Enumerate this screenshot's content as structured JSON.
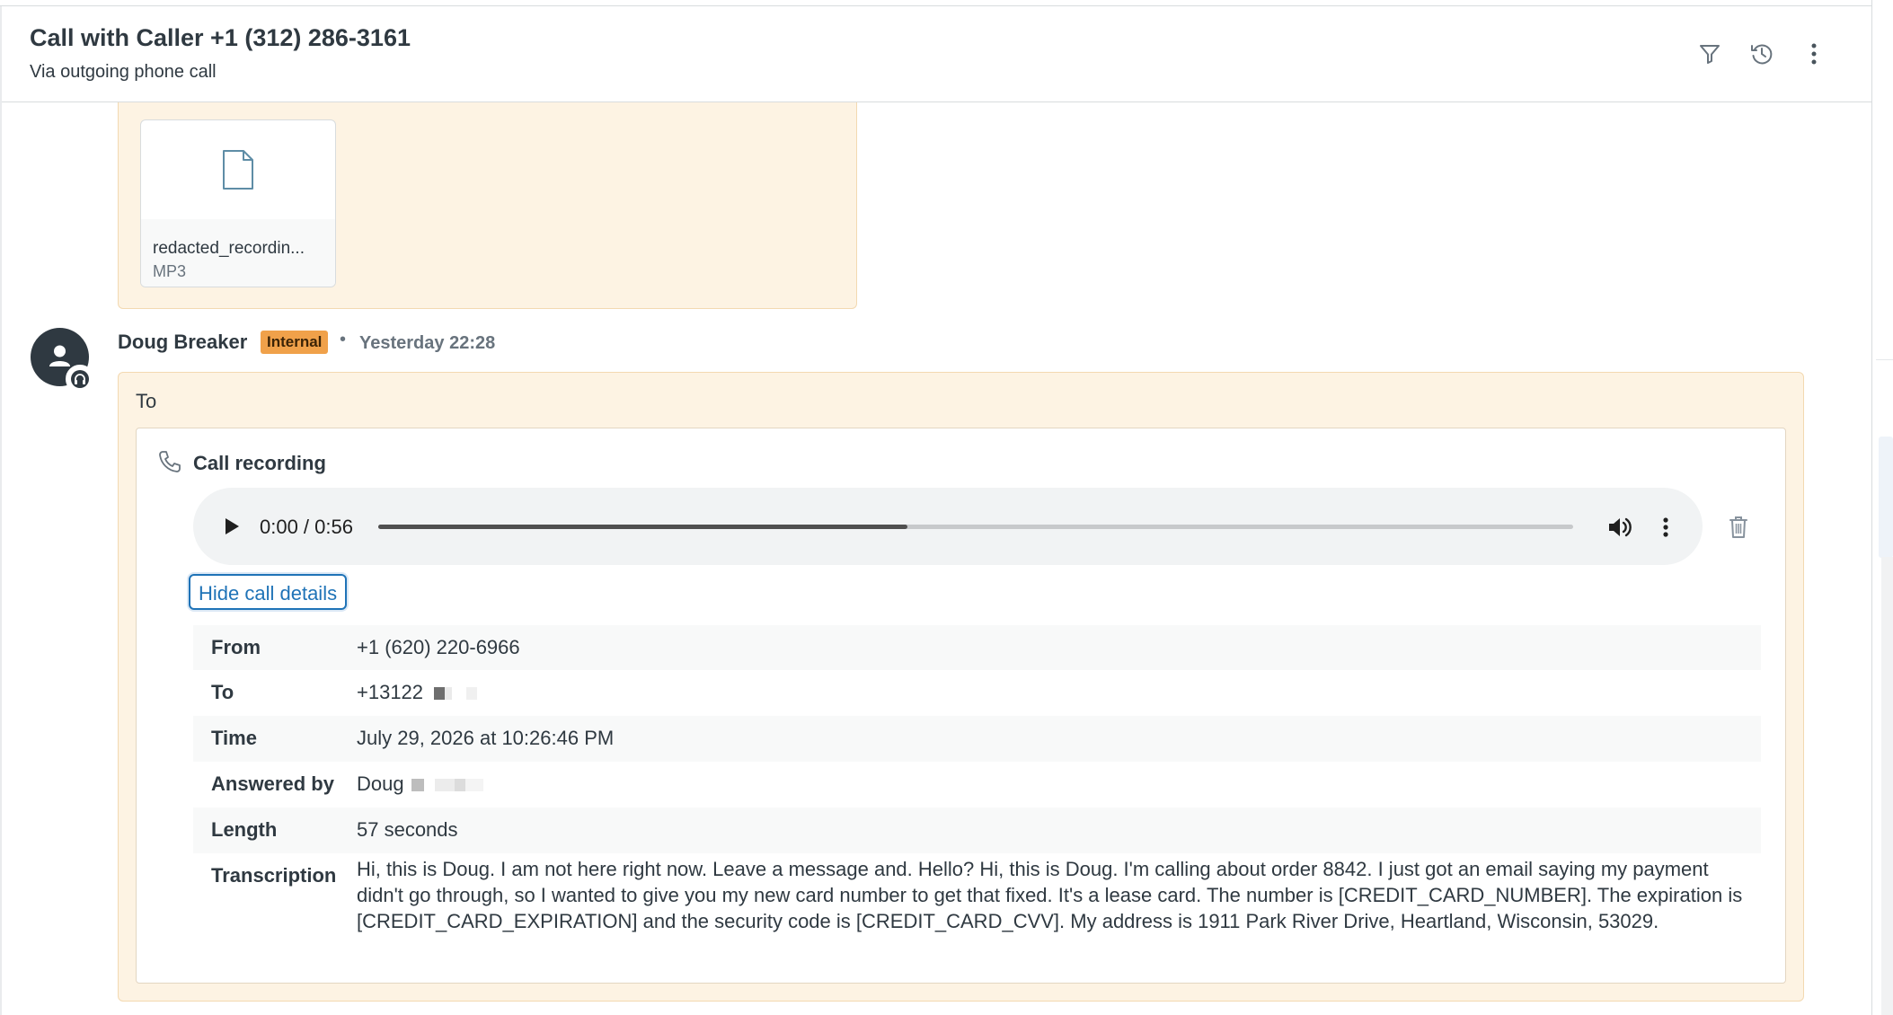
{
  "header": {
    "title": "Call with Caller +1 (312) 286-3161",
    "subtitle": "Via outgoing phone call",
    "icons": [
      "filter-icon",
      "history-icon",
      "more-vertical-icon"
    ]
  },
  "attachment": {
    "file_name": "redacted_recordin...",
    "file_type": "MP3",
    "icon": "file-icon"
  },
  "comment": {
    "author": "Doug Breaker",
    "badge": "Internal",
    "separator": "•",
    "timestamp": "Yesterday 22:28",
    "to_label": "To",
    "recording_title": "Call recording",
    "audio": {
      "time_display": "0:00 / 0:56",
      "progress_fraction": 0.443
    },
    "hide_details_label": "Hide call details",
    "details": [
      {
        "label": "From",
        "value": "+1 (620) 220-6966"
      },
      {
        "label": "To",
        "value": "+13122"
      },
      {
        "label": "Time",
        "value": "July 29, 2026 at 10:26:46 PM"
      },
      {
        "label": "Answered by",
        "value": "Doug"
      },
      {
        "label": "Length",
        "value": "57 seconds"
      },
      {
        "label": "Transcription",
        "value": "Hi, this is Doug. I am not here right now. Leave a message and. Hello? Hi, this is Doug. I'm calling about order 8842. I just got an email saying my payment didn't go through, so I wanted to give you my new card number to get that fixed. It's a lease card. The number is [CREDIT_CARD_NUMBER]. The expiration is [CREDIT_CARD_EXPIRATION] and the security code is [CREDIT_CARD_CVV]. My address is 1911 Park River Drive, Heartland, Wisconsin, 53029."
      }
    ]
  },
  "colors": {
    "note_background": "#fdf3e3",
    "internal_badge": "#f0a14a",
    "link_blue": "#1f73b7"
  }
}
